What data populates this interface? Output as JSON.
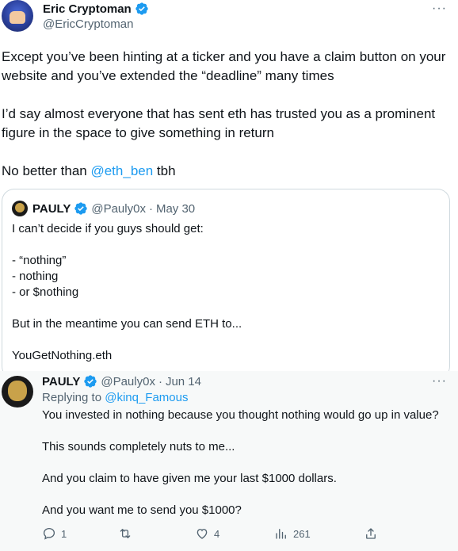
{
  "main_tweet": {
    "display_name": "Eric Cryptoman",
    "handle": "@EricCryptoman",
    "more_icon": "more-dots-icon",
    "paragraphs": [
      "Except you’ve been hinting at a ticker and you have a claim button on your website and you’ve extended the “deadline” many times",
      "I’d say almost everyone that has sent eth has trusted you as a prominent figure in the space to give something in return"
    ],
    "last_line_prefix": "No better than ",
    "last_line_mention": "@eth_ben",
    "last_line_suffix": " tbh"
  },
  "quote": {
    "display_name": "PAULY",
    "handle": "@Pauly0x",
    "separator": "·",
    "date": "May 30",
    "lines": [
      "I can’t decide if you guys should get:",
      "",
      "- “nothing”",
      "- nothing",
      "- or $nothing",
      "",
      "But in the meantime you can send ETH to...",
      "",
      "YouGetNothing.eth"
    ]
  },
  "reply": {
    "display_name": "PAULY",
    "handle": "@Pauly0x",
    "separator": "·",
    "date": "Jun 14",
    "replying_prefix": "Replying to ",
    "replying_to": "@kinq_Famous",
    "paragraphs": [
      "You invested in nothing because you thought nothing would go up in value?",
      "This sounds completely nuts to me...",
      "And you claim to have given me your last $1000 dollars.",
      "And you want me to send you $1000?"
    ],
    "actions": {
      "replies": "1",
      "retweets": "",
      "likes": "4",
      "views": "261"
    }
  },
  "colors": {
    "accent": "#1d9bf0",
    "muted": "#536471",
    "text": "#0f1419"
  }
}
